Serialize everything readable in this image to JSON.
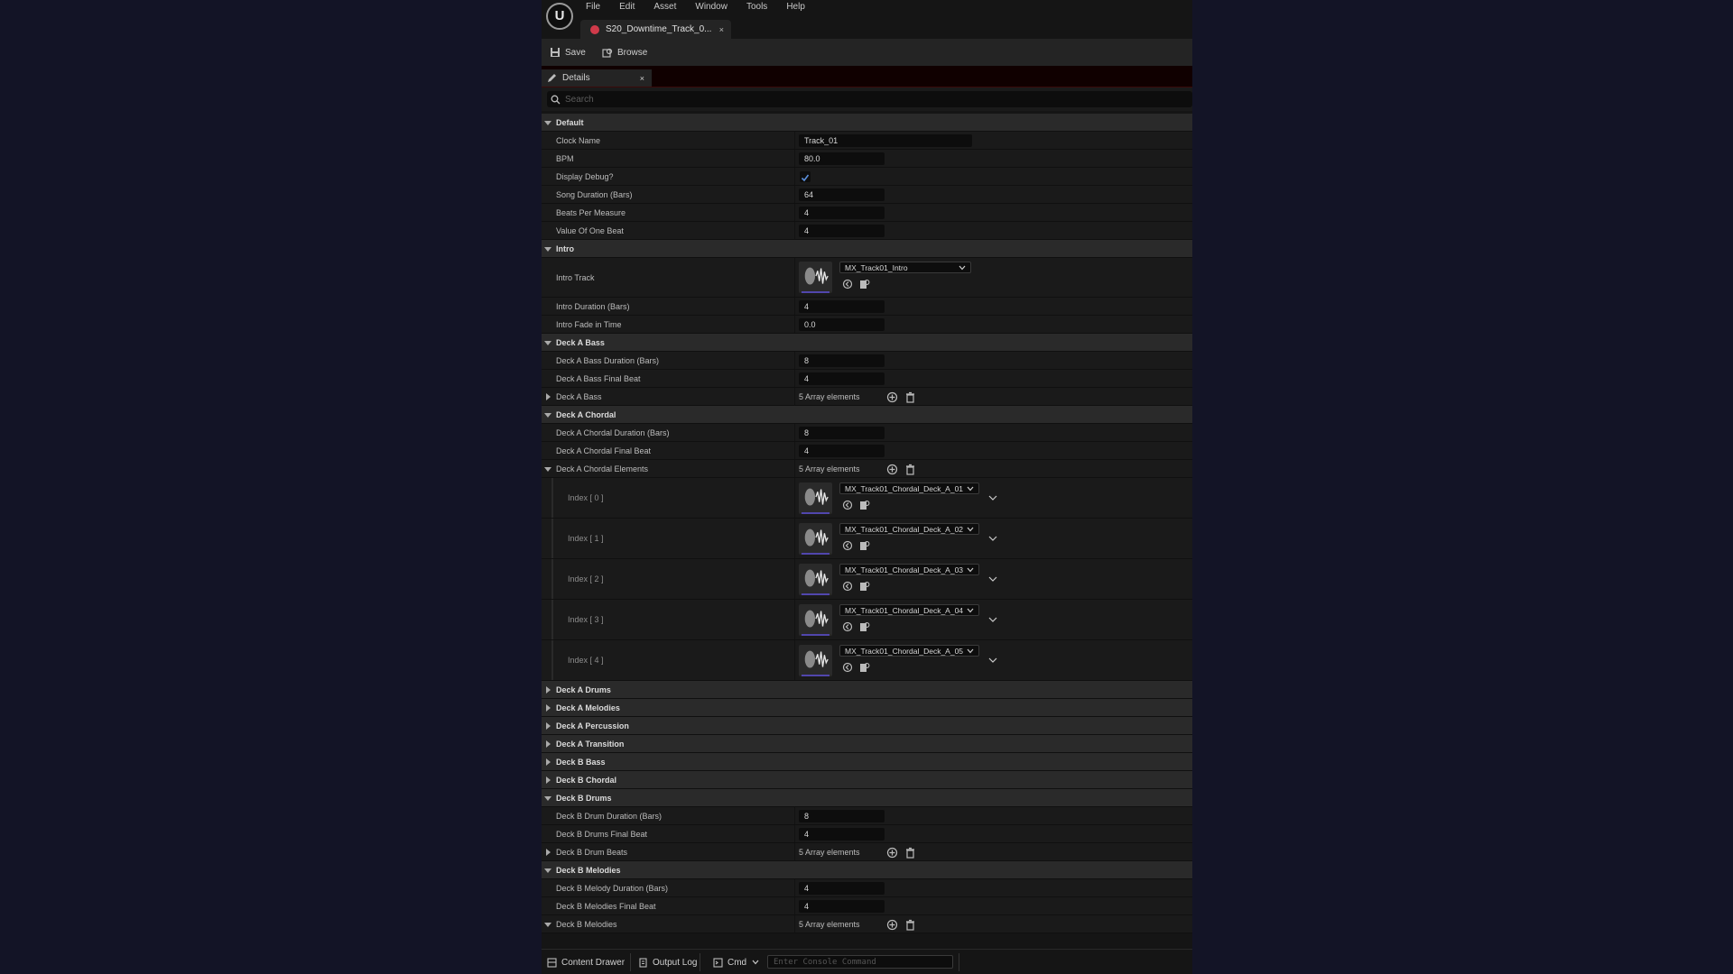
{
  "menu": [
    "File",
    "Edit",
    "Asset",
    "Window",
    "Tools",
    "Help"
  ],
  "doc_tab": {
    "title": "S20_Downtime_Track_0...",
    "close": "×"
  },
  "toolbar": {
    "save": "Save",
    "browse": "Browse"
  },
  "details_tab": {
    "title": "Details",
    "close": "×"
  },
  "search": {
    "placeholder": "Search"
  },
  "sections": {
    "default": {
      "title": "Default",
      "clock_name": {
        "label": "Clock Name",
        "value": "Track_01"
      },
      "bpm": {
        "label": "BPM",
        "value": "80.0"
      },
      "display_debug": {
        "label": "Display Debug?"
      },
      "song_duration": {
        "label": "Song Duration (Bars)",
        "value": "64"
      },
      "beats_per_measure": {
        "label": "Beats Per Measure",
        "value": "4"
      },
      "value_of_one_beat": {
        "label": "Value Of One Beat",
        "value": "4"
      }
    },
    "intro": {
      "title": "Intro",
      "intro_track": {
        "label": "Intro Track",
        "value": "MX_Track01_Intro"
      },
      "intro_duration": {
        "label": "Intro Duration (Bars)",
        "value": "4"
      },
      "intro_fade": {
        "label": "Intro Fade in Time",
        "value": "0.0"
      }
    },
    "deck_a_bass": {
      "title": "Deck A Bass",
      "duration": {
        "label": "Deck A Bass Duration (Bars)",
        "value": "8"
      },
      "final_beat": {
        "label": "Deck A Bass Final Beat",
        "value": "4"
      },
      "array": {
        "label": "Deck A Bass",
        "value": "5 Array elements"
      }
    },
    "deck_a_chordal": {
      "title": "Deck A Chordal",
      "duration": {
        "label": "Deck A Chordal Duration (Bars)",
        "value": "8"
      },
      "final_beat": {
        "label": "Deck A Chordal Final Beat",
        "value": "4"
      },
      "array": {
        "label": "Deck A Chordal Elements",
        "value": "5 Array elements"
      },
      "elements": [
        {
          "label": "Index [ 0 ]",
          "value": "MX_Track01_Chordal_Deck_A_01"
        },
        {
          "label": "Index [ 1 ]",
          "value": "MX_Track01_Chordal_Deck_A_02"
        },
        {
          "label": "Index [ 2 ]",
          "value": "MX_Track01_Chordal_Deck_A_03"
        },
        {
          "label": "Index [ 3 ]",
          "value": "MX_Track01_Chordal_Deck_A_04"
        },
        {
          "label": "Index [ 4 ]",
          "value": "MX_Track01_Chordal_Deck_A_05"
        }
      ]
    },
    "collapsed": [
      "Deck A Drums",
      "Deck A Melodies",
      "Deck A Percussion",
      "Deck A Transition",
      "Deck B Bass",
      "Deck B Chordal"
    ],
    "deck_b_drums": {
      "title": "Deck B Drums",
      "duration": {
        "label": "Deck B Drum Duration (Bars)",
        "value": "8"
      },
      "final_beat": {
        "label": "Deck B Drums Final Beat",
        "value": "4"
      },
      "array": {
        "label": "Deck B Drum Beats",
        "value": "5 Array elements"
      }
    },
    "deck_b_melodies": {
      "title": "Deck B Melodies",
      "duration": {
        "label": "Deck B Melody Duration (Bars)",
        "value": "4"
      },
      "final_beat": {
        "label": "Deck B Melodies Final Beat",
        "value": "4"
      },
      "array": {
        "label": "Deck B Melodies",
        "value": "5 Array elements"
      }
    }
  },
  "statusbar": {
    "content_drawer": "Content Drawer",
    "output_log": "Output Log",
    "cmd": "Cmd",
    "console_placeholder": "Enter Console Command"
  },
  "colors": {
    "accent": "#5146ad",
    "doc_dot": "#d03a4a",
    "background": "#131426"
  }
}
